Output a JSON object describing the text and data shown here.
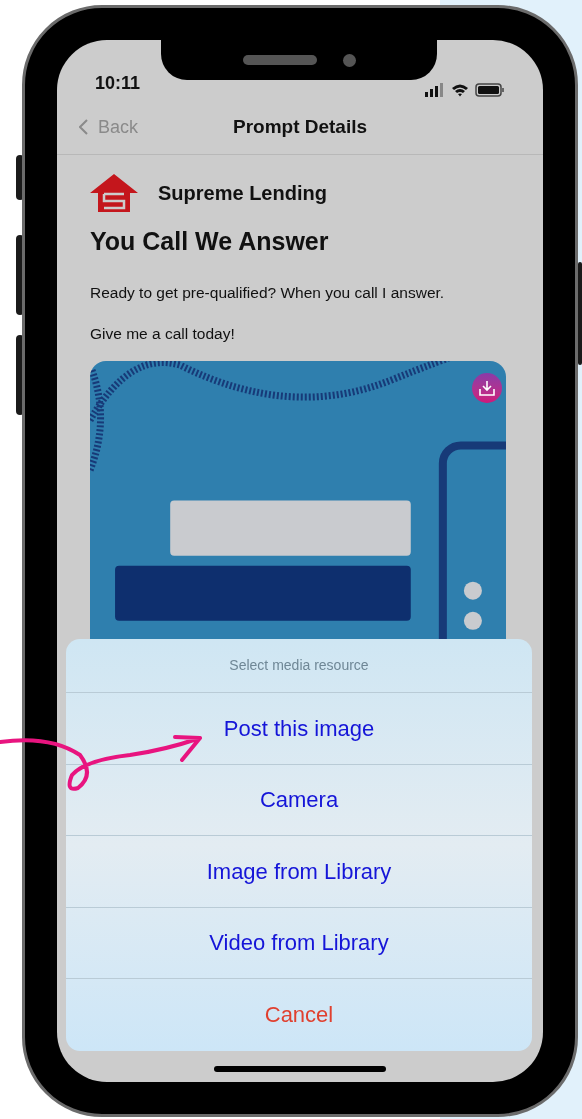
{
  "status_bar": {
    "time": "10:11"
  },
  "nav": {
    "back": "Back",
    "title": "Prompt Details"
  },
  "brand": {
    "name": "Supreme Lending"
  },
  "prompt": {
    "title": "You Call We Answer",
    "paragraphs": [
      "Ready to get pre-qualified? When you call I answer.",
      "Give me a call today!"
    ]
  },
  "action_sheet": {
    "title": "Select media resource",
    "actions": [
      {
        "label": "Post this image",
        "kind": "default"
      },
      {
        "label": "Camera",
        "kind": "default"
      },
      {
        "label": "Image from Library",
        "kind": "default"
      },
      {
        "label": "Video from Library",
        "kind": "default"
      },
      {
        "label": "Cancel",
        "kind": "cancel"
      }
    ]
  }
}
